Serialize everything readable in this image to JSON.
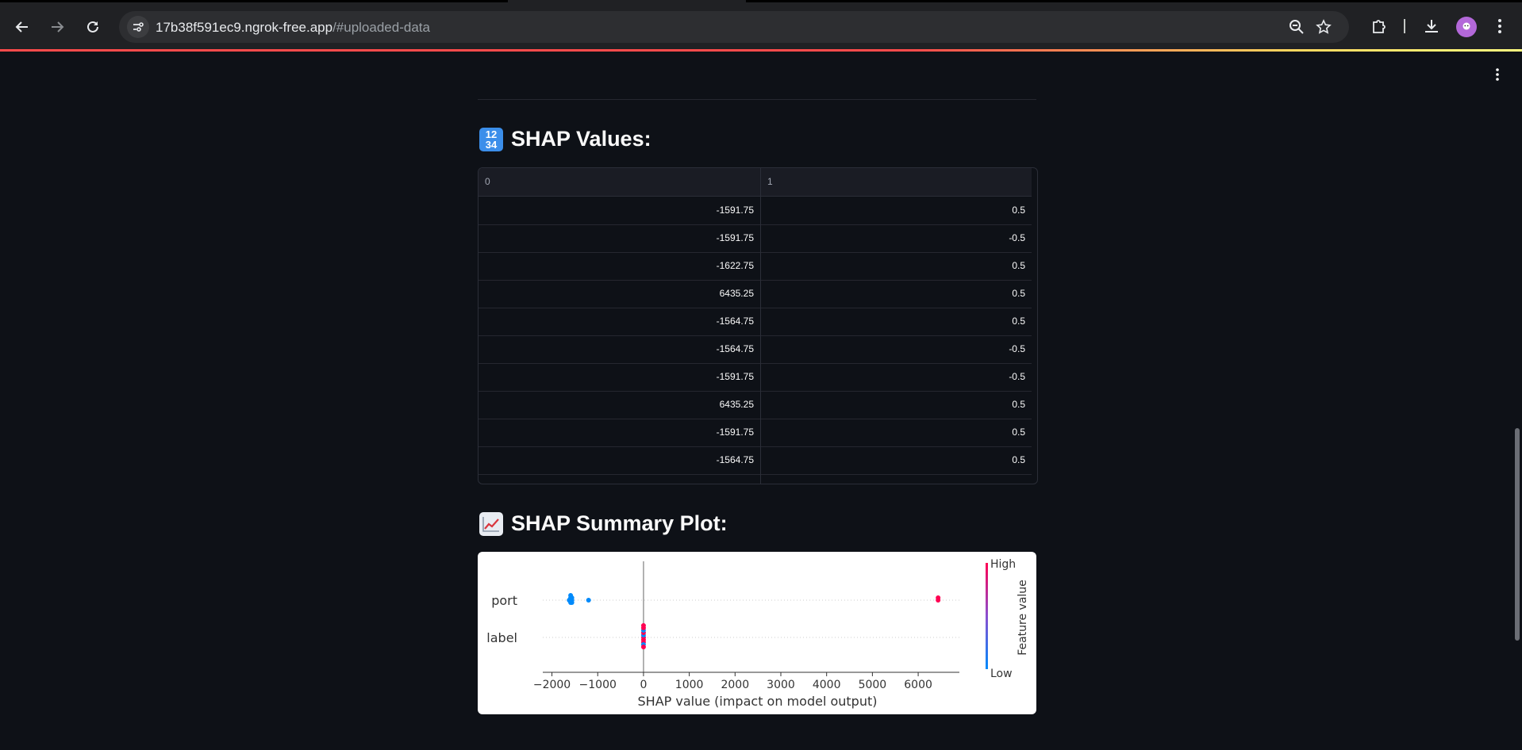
{
  "browser": {
    "url_host": "17b38f591ec9.ngrok-free.app",
    "url_path": "/#uploaded-data"
  },
  "shap_values": {
    "heading": "SHAP Values:",
    "emoji": "🔢",
    "columns": [
      "0",
      "1"
    ],
    "rows": [
      [
        "-1591.75",
        "0.5"
      ],
      [
        "-1591.75",
        "-0.5"
      ],
      [
        "-1622.75",
        "0.5"
      ],
      [
        "6435.25",
        "0.5"
      ],
      [
        "-1564.75",
        "0.5"
      ],
      [
        "-1564.75",
        "-0.5"
      ],
      [
        "-1591.75",
        "-0.5"
      ],
      [
        "6435.25",
        "0.5"
      ],
      [
        "-1591.75",
        "0.5"
      ],
      [
        "-1564.75",
        "0.5"
      ]
    ]
  },
  "summary_plot": {
    "heading": "SHAP Summary Plot:",
    "emoji": "📈"
  },
  "chart_data": {
    "type": "scatter",
    "title": "",
    "xlabel": "SHAP value (impact on model output)",
    "ylabel": "",
    "xlim": [
      -2200,
      6900
    ],
    "xticks": [
      -2000,
      -1000,
      0,
      1000,
      2000,
      3000,
      4000,
      5000,
      6000
    ],
    "xtick_labels": [
      "−2000",
      "−1000",
      "0",
      "1000",
      "2000",
      "3000",
      "4000",
      "5000",
      "6000"
    ],
    "features": [
      "port",
      "label"
    ],
    "colorbar": {
      "label": "Feature value",
      "high": "High",
      "low": "Low",
      "high_color": "#ff0052",
      "low_color": "#008afb"
    },
    "series": [
      {
        "name": "port",
        "points": [
          {
            "x": -1622.75,
            "level": "low"
          },
          {
            "x": -1591.75,
            "level": "low"
          },
          {
            "x": -1591.75,
            "level": "low"
          },
          {
            "x": -1591.75,
            "level": "low"
          },
          {
            "x": -1591.75,
            "level": "low"
          },
          {
            "x": -1564.75,
            "level": "low"
          },
          {
            "x": -1564.75,
            "level": "low"
          },
          {
            "x": -1564.75,
            "level": "low"
          },
          {
            "x": -1200,
            "level": "low"
          },
          {
            "x": 6435.25,
            "level": "high"
          },
          {
            "x": 6435.25,
            "level": "high"
          }
        ]
      },
      {
        "name": "label",
        "points": [
          {
            "x": 0.5,
            "level": "high"
          },
          {
            "x": -0.5,
            "level": "low"
          },
          {
            "x": 0.5,
            "level": "high"
          },
          {
            "x": 0.5,
            "level": "high"
          },
          {
            "x": 0.5,
            "level": "high"
          },
          {
            "x": -0.5,
            "level": "low"
          },
          {
            "x": -0.5,
            "level": "low"
          },
          {
            "x": 0.5,
            "level": "high"
          },
          {
            "x": 0.5,
            "level": "high"
          },
          {
            "x": 0.5,
            "level": "high"
          }
        ]
      }
    ]
  }
}
